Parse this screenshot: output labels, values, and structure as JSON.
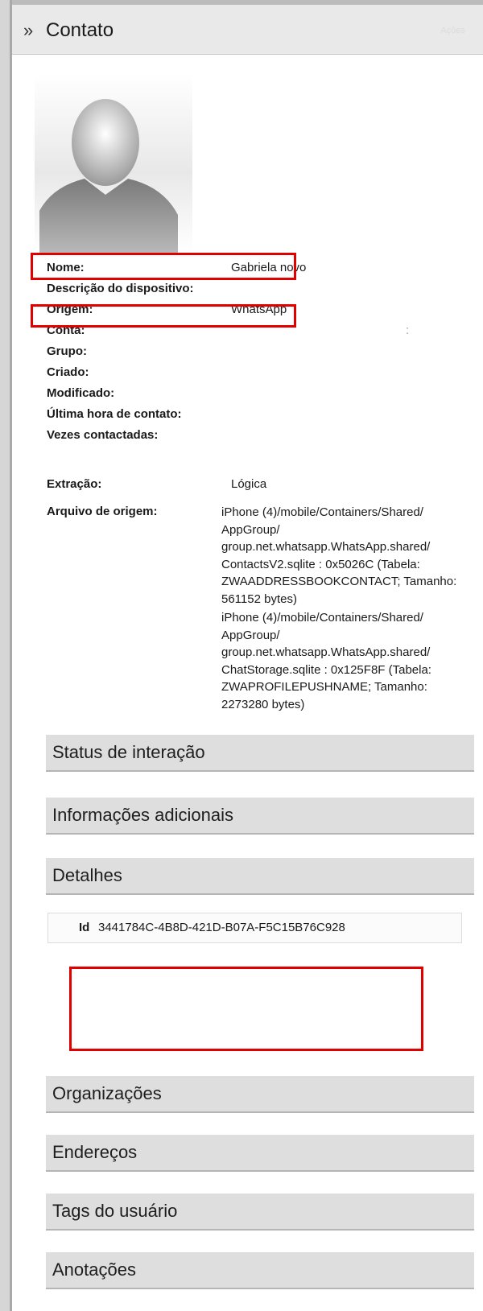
{
  "header": {
    "chevron": "»",
    "title": "Contato",
    "faint_text": "Ações"
  },
  "avatar": {
    "icon": "person-silhouette-icon"
  },
  "properties": [
    {
      "label": "Nome:",
      "value": "Gabriela novo"
    },
    {
      "label": "Descrição do dispositivo:",
      "value": ""
    },
    {
      "label": "Origem:",
      "value": "WhatsApp"
    },
    {
      "label": "Conta:",
      "value": ":"
    },
    {
      "label": "Grupo:",
      "value": ""
    },
    {
      "label": "Criado:",
      "value": ""
    },
    {
      "label": "Modificado:",
      "value": ""
    },
    {
      "label": "Última hora de contato:",
      "value": ""
    },
    {
      "label": "Vezes contactadas:",
      "value": ""
    },
    {
      "label": "Extração:",
      "value": "Lógica"
    },
    {
      "label": "Arquivo de origem:",
      "value": ""
    }
  ],
  "source_files": [
    "iPhone (4)/mobile/Containers/Shared/ AppGroup/ group.net.whatsapp.WhatsApp.shared/ ContactsV2.sqlite : 0x5026C (Tabela: ZWAADDRESSBOOKCONTACT; Tamanho: 561152 bytes)",
    "iPhone (4)/mobile/Containers/Shared/ AppGroup/ group.net.whatsapp.WhatsApp.shared/ ChatStorage.sqlite : 0x125F8F (Tabela: ZWAPROFILEPUSHNAME; Tamanho: 2273280 bytes)"
  ],
  "sections": {
    "status": "Status de interação",
    "info": "Informações adicionais",
    "details": "Detalhes",
    "orgs": "Organizações",
    "addresses": "Endereços",
    "tags": "Tags do usuário",
    "notes": "Anotações"
  },
  "details": {
    "id_label": "Id",
    "id_value": "3441784C-4B8D-421D-B07A-F5C15B76C928"
  },
  "colors": {
    "highlight": "#e00000",
    "section_bg": "#dedede"
  }
}
